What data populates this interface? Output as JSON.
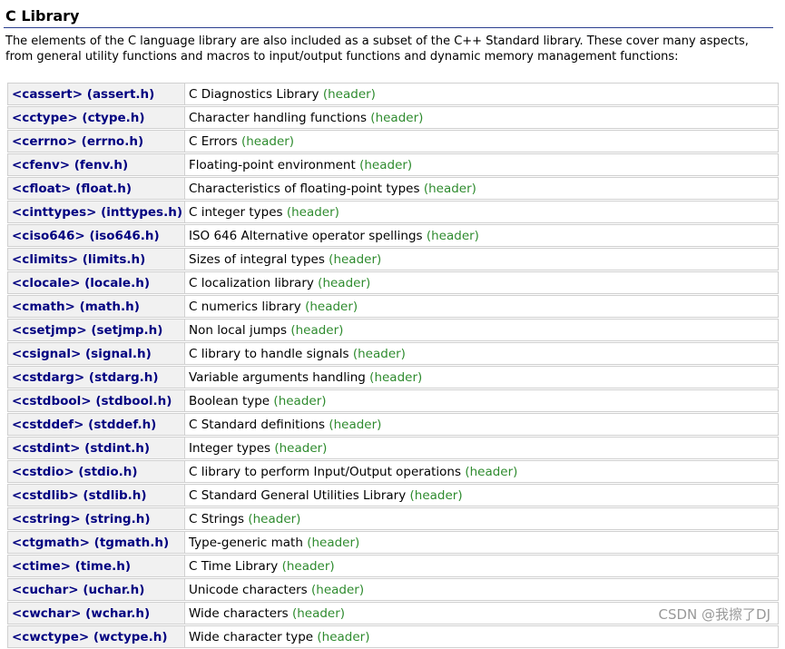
{
  "title": "C Library",
  "intro": "The elements of the C language library are also included as a subset of the C++ Standard library. These cover many aspects, from general utility functions and macros to input/output functions and dynamic memory management functions:",
  "header_tag": "(header)",
  "colors": {
    "link": "#000080",
    "header_tag": "#2e8b2e",
    "name_cell_bg": "#f1f1f1",
    "rule": "#2b3f8f"
  },
  "rows": [
    {
      "name": "<cassert> (assert.h)",
      "desc": "C Diagnostics Library"
    },
    {
      "name": "<cctype> (ctype.h)",
      "desc": "Character handling functions"
    },
    {
      "name": "<cerrno> (errno.h)",
      "desc": "C Errors"
    },
    {
      "name": "<cfenv> (fenv.h)",
      "desc": "Floating-point environment"
    },
    {
      "name": "<cfloat> (float.h)",
      "desc": "Characteristics of floating-point types"
    },
    {
      "name": "<cinttypes> (inttypes.h)",
      "desc": "C integer types"
    },
    {
      "name": "<ciso646> (iso646.h)",
      "desc": "ISO 646 Alternative operator spellings"
    },
    {
      "name": "<climits> (limits.h)",
      "desc": "Sizes of integral types"
    },
    {
      "name": "<clocale> (locale.h)",
      "desc": "C localization library"
    },
    {
      "name": "<cmath> (math.h)",
      "desc": "C numerics library"
    },
    {
      "name": "<csetjmp> (setjmp.h)",
      "desc": "Non local jumps"
    },
    {
      "name": "<csignal> (signal.h)",
      "desc": "C library to handle signals"
    },
    {
      "name": "<cstdarg> (stdarg.h)",
      "desc": "Variable arguments handling"
    },
    {
      "name": "<cstdbool> (stdbool.h)",
      "desc": "Boolean type"
    },
    {
      "name": "<cstddef> (stddef.h)",
      "desc": "C Standard definitions"
    },
    {
      "name": "<cstdint> (stdint.h)",
      "desc": "Integer types"
    },
    {
      "name": "<cstdio> (stdio.h)",
      "desc": "C library to perform Input/Output operations"
    },
    {
      "name": "<cstdlib> (stdlib.h)",
      "desc": "C Standard General Utilities Library"
    },
    {
      "name": "<cstring> (string.h)",
      "desc": "C Strings"
    },
    {
      "name": "<ctgmath> (tgmath.h)",
      "desc": "Type-generic math"
    },
    {
      "name": "<ctime> (time.h)",
      "desc": "C Time Library"
    },
    {
      "name": "<cuchar> (uchar.h)",
      "desc": "Unicode characters"
    },
    {
      "name": "<cwchar> (wchar.h)",
      "desc": "Wide characters"
    },
    {
      "name": "<cwctype> (wctype.h)",
      "desc": "Wide character type"
    }
  ],
  "watermark": "CSDN @我擦了DJ"
}
